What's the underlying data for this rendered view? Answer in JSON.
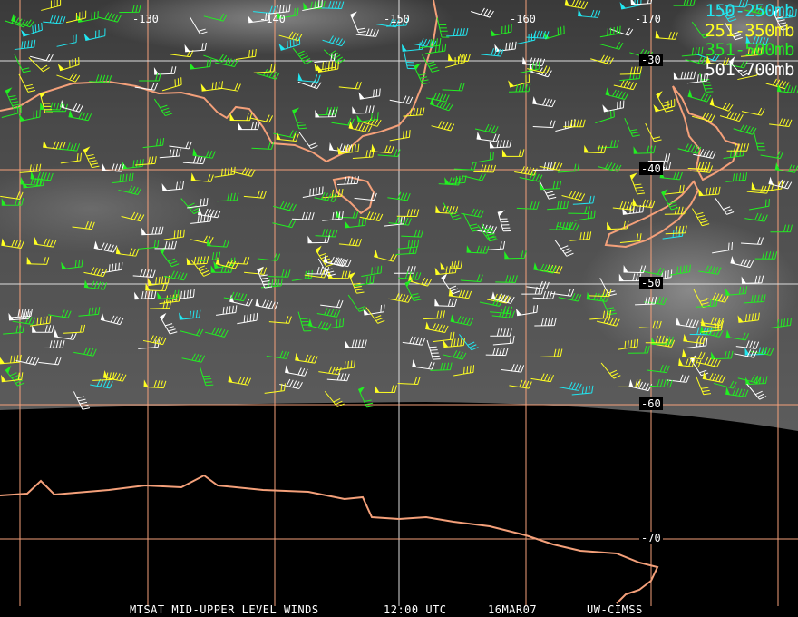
{
  "legend": [
    {
      "label": "150-250mb",
      "color": "#22e6f0"
    },
    {
      "label": "251-350mb",
      "color": "#ffff22"
    },
    {
      "label": "351-500mb",
      "color": "#22ee22"
    },
    {
      "label": "501-700mb",
      "color": "#ffffff"
    }
  ],
  "longitude_labels": [
    "-130",
    "-140",
    "-150",
    "-160",
    "-170"
  ],
  "latitude_labels": [
    "-30",
    "-40",
    "-50",
    "-60",
    "-70"
  ],
  "footer": {
    "product": "MTSAT MID-UPPER LEVEL WINDS",
    "time": "12:00 UTC",
    "date": "16MAR07",
    "source": "UW-CIMSS"
  },
  "colors": {
    "grid": "#f4a07a",
    "coast": "#f4a07a",
    "background": "#000000"
  }
}
